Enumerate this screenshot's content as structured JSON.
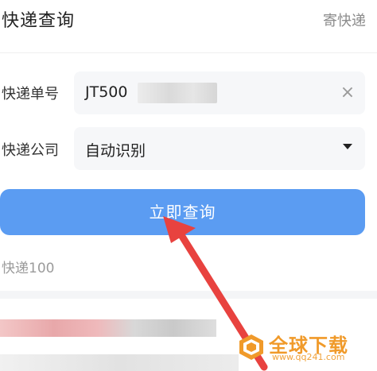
{
  "header": {
    "title": "快递查询",
    "send_link": "寄快递"
  },
  "form": {
    "tracking_label": "快递单号",
    "tracking_value": "JT500",
    "company_label": "快递公司",
    "company_value": "自动识别"
  },
  "actions": {
    "query_label": "立即查询"
  },
  "brand": {
    "name": "快递100"
  },
  "watermark": {
    "text": "全球下载",
    "url": "www.qq241.com"
  },
  "colors": {
    "primary_button": "#5b9cf2",
    "arrow": "#e8423f",
    "watermark": "#f09a2a"
  },
  "icons": {
    "clear": "close-icon",
    "dropdown": "caret-down-icon"
  }
}
